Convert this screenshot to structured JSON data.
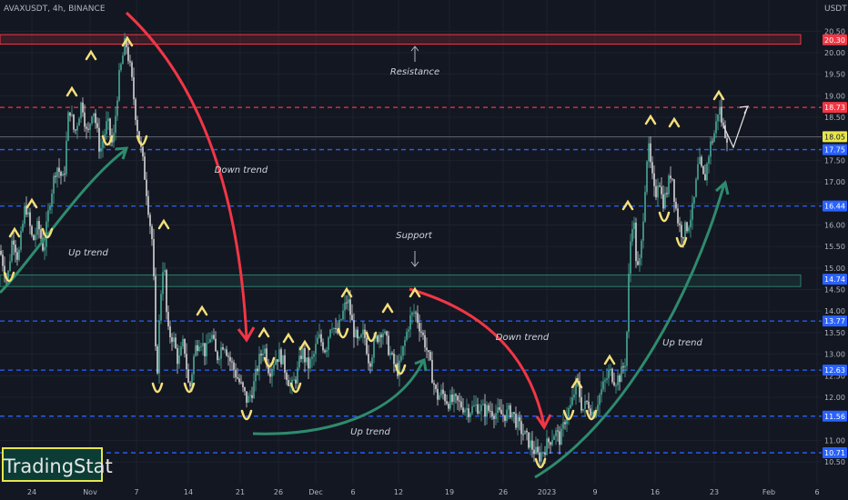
{
  "header": {
    "symbol": "AVAXUSDT, 4h, BINANCE",
    "currency": "USDT"
  },
  "brand": "TradingStat",
  "chart_data": {
    "type": "candlestick",
    "symbol": "AVAXUSDT",
    "timeframe": "4h",
    "exchange": "BINANCE",
    "y_ticks": [
      10.5,
      11.0,
      11.5,
      12.0,
      12.5,
      13.0,
      13.5,
      14.0,
      14.5,
      15.0,
      15.5,
      16.0,
      16.5,
      17.0,
      17.5,
      18.0,
      18.5,
      19.0,
      19.5,
      20.0,
      20.5
    ],
    "ylim": [
      10.2,
      20.75
    ],
    "x_ticks": [
      "24",
      "Nov",
      "7",
      "14",
      "21",
      "26",
      "Dec",
      "6",
      "12",
      "19",
      "26",
      "2023",
      "9",
      "16",
      "23",
      "Feb",
      "6"
    ],
    "current_price": "18.05",
    "price_tags": [
      {
        "value": "20.30",
        "color": "#f23645"
      },
      {
        "value": "18.73",
        "color": "#f23645"
      },
      {
        "value": "18.05",
        "color": "#e8e54d"
      },
      {
        "value": "17.75",
        "color": "#2962ff"
      },
      {
        "value": "16.44",
        "color": "#2962ff"
      },
      {
        "value": "14.74",
        "color": "#2962ff"
      },
      {
        "value": "13.77",
        "color": "#2962ff"
      },
      {
        "value": "12.63",
        "color": "#2962ff"
      },
      {
        "value": "11.56",
        "color": "#2962ff"
      },
      {
        "value": "10.71",
        "color": "#2962ff"
      }
    ],
    "resistance_lines": [
      18.73
    ],
    "support_lines": [
      17.75,
      16.44,
      13.77,
      12.63,
      11.56,
      10.71
    ],
    "zones": [
      {
        "name": "Resistance",
        "low": 20.2,
        "high": 20.42,
        "color": "#f23645"
      },
      {
        "name": "Support",
        "low": 14.57,
        "high": 14.84,
        "color": "#2e7d68"
      }
    ],
    "annotations": [
      "Resistance",
      "Support",
      "Down trend",
      "Up trend",
      "Down trend",
      "Up trend",
      "Up trend"
    ],
    "price_path": [
      [
        0,
        15.4
      ],
      [
        8,
        14.7
      ],
      [
        14,
        15.8
      ],
      [
        20,
        15.2
      ],
      [
        28,
        16.5
      ],
      [
        36,
        15.6
      ],
      [
        42,
        16.0
      ],
      [
        48,
        15.4
      ],
      [
        55,
        16.6
      ],
      [
        62,
        17.4
      ],
      [
        70,
        17.0
      ],
      [
        76,
        18.8
      ],
      [
        82,
        18.1
      ],
      [
        90,
        18.9
      ],
      [
        96,
        18.0
      ],
      [
        102,
        18.8
      ],
      [
        110,
        17.7
      ],
      [
        118,
        18.4
      ],
      [
        124,
        17.8
      ],
      [
        130,
        19.3
      ],
      [
        138,
        20.3
      ],
      [
        144,
        19.5
      ],
      [
        150,
        18.4
      ],
      [
        156,
        17.6
      ],
      [
        160,
        17.0
      ],
      [
        164,
        16.2
      ],
      [
        168,
        15.5
      ],
      [
        172,
        12.2
      ],
      [
        176,
        14.2
      ],
      [
        180,
        15.3
      ],
      [
        184,
        13.5
      ],
      [
        190,
        13.4
      ],
      [
        196,
        12.8
      ],
      [
        202,
        13.3
      ],
      [
        208,
        12.1
      ],
      [
        214,
        13.1
      ],
      [
        220,
        13.4
      ],
      [
        226,
        13.0
      ],
      [
        232,
        13.5
      ],
      [
        238,
        12.9
      ],
      [
        246,
        13.3
      ],
      [
        252,
        12.9
      ],
      [
        258,
        12.6
      ],
      [
        264,
        12.3
      ],
      [
        272,
        11.9
      ],
      [
        278,
        12.2
      ],
      [
        284,
        12.8
      ],
      [
        290,
        13.2
      ],
      [
        296,
        12.6
      ],
      [
        302,
        12.9
      ],
      [
        308,
        13.0
      ],
      [
        314,
        12.6
      ],
      [
        320,
        12.2
      ],
      [
        326,
        12.5
      ],
      [
        332,
        13.1
      ],
      [
        338,
        12.7
      ],
      [
        344,
        12.9
      ],
      [
        350,
        13.4
      ],
      [
        358,
        13.1
      ],
      [
        364,
        13.8
      ],
      [
        370,
        13.4
      ],
      [
        376,
        13.9
      ],
      [
        382,
        14.3
      ],
      [
        388,
        13.6
      ],
      [
        394,
        13.2
      ],
      [
        400,
        13.5
      ],
      [
        406,
        12.8
      ],
      [
        412,
        13.3
      ],
      [
        420,
        13.6
      ],
      [
        426,
        13.2
      ],
      [
        432,
        12.8
      ],
      [
        438,
        12.6
      ],
      [
        444,
        13.2
      ],
      [
        450,
        13.8
      ],
      [
        456,
        14.0
      ],
      [
        462,
        13.6
      ],
      [
        468,
        13.2
      ],
      [
        474,
        12.6
      ],
      [
        480,
        12.0
      ],
      [
        486,
        12.1
      ],
      [
        492,
        11.9
      ],
      [
        500,
        11.9
      ],
      [
        508,
        11.8
      ],
      [
        516,
        11.7
      ],
      [
        524,
        11.8
      ],
      [
        532,
        11.7
      ],
      [
        540,
        11.7
      ],
      [
        548,
        11.6
      ],
      [
        556,
        11.6
      ],
      [
        562,
        11.7
      ],
      [
        568,
        11.4
      ],
      [
        574,
        11.2
      ],
      [
        580,
        11.0
      ],
      [
        586,
        10.8
      ],
      [
        592,
        10.6
      ],
      [
        598,
        10.8
      ],
      [
        604,
        11.0
      ],
      [
        610,
        11.2
      ],
      [
        616,
        11.0
      ],
      [
        622,
        11.6
      ],
      [
        628,
        11.8
      ],
      [
        634,
        12.4
      ],
      [
        640,
        11.7
      ],
      [
        646,
        11.9
      ],
      [
        652,
        11.6
      ],
      [
        658,
        12.0
      ],
      [
        664,
        12.3
      ],
      [
        670,
        12.6
      ],
      [
        676,
        12.4
      ],
      [
        682,
        12.5
      ],
      [
        688,
        12.9
      ],
      [
        692,
        15.4
      ],
      [
        696,
        16.3
      ],
      [
        700,
        14.9
      ],
      [
        704,
        15.2
      ],
      [
        708,
        16.6
      ],
      [
        712,
        17.9
      ],
      [
        716,
        17.2
      ],
      [
        720,
        16.6
      ],
      [
        724,
        17.2
      ],
      [
        728,
        16.5
      ],
      [
        732,
        16.7
      ],
      [
        738,
        17.3
      ],
      [
        742,
        16.5
      ],
      [
        746,
        16.0
      ],
      [
        750,
        15.8
      ],
      [
        756,
        16.0
      ],
      [
        762,
        16.4
      ],
      [
        768,
        17.5
      ],
      [
        774,
        17.0
      ],
      [
        780,
        17.8
      ],
      [
        786,
        18.2
      ],
      [
        790,
        18.8
      ],
      [
        794,
        18.3
      ],
      [
        798,
        18.1
      ],
      [
        800,
        18.05
      ]
    ]
  }
}
